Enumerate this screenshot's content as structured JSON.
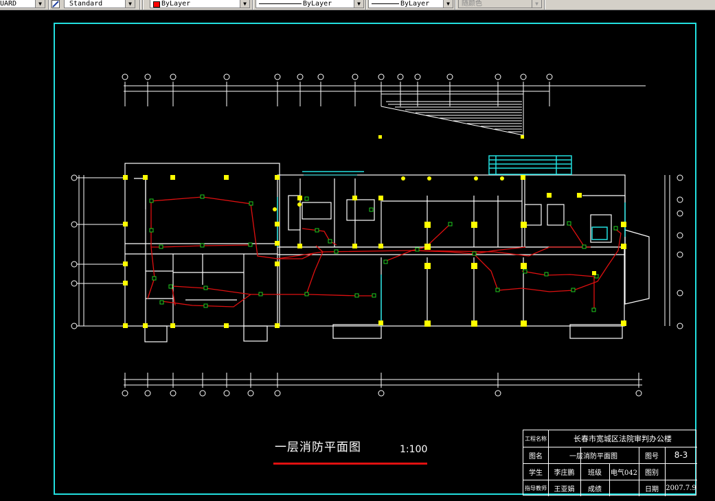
{
  "toolbar": {
    "dimstyle_value": "UARD",
    "textstyle_value": "Standard",
    "color_value": "ByLayer",
    "linetype_value": "ByLayer",
    "lineweight_value": "ByLayer",
    "plotstyle_value": "随颜色",
    "dropdown_glyph": "▼"
  },
  "colors": {
    "frame": "#22e0e0",
    "wall": "#ffffff",
    "fire_wire": "#e01010",
    "device": "#20d020",
    "column": "#ffff00",
    "underline": "#e01010"
  },
  "drawing": {
    "title": "一层消防平面图",
    "scale": "1:100"
  },
  "title_block": {
    "project_label": "工程名称",
    "project_name": "长春市宽城区法院审判办公楼",
    "drawing_label": "图名",
    "drawing_name": "一层消防平面图",
    "number_label": "图号",
    "number_value": "8-3",
    "student_label": "学生",
    "student_name": "李庄鹏",
    "class_label": "班级",
    "class_value": "电气042",
    "sheet_label": "图别",
    "sheet_value": "",
    "teacher_label": "指导教师",
    "teacher_name": "王亚娟",
    "grade_label": "成绩",
    "grade_value": "",
    "date_label": "日期",
    "date_value": "2007.7.9"
  }
}
